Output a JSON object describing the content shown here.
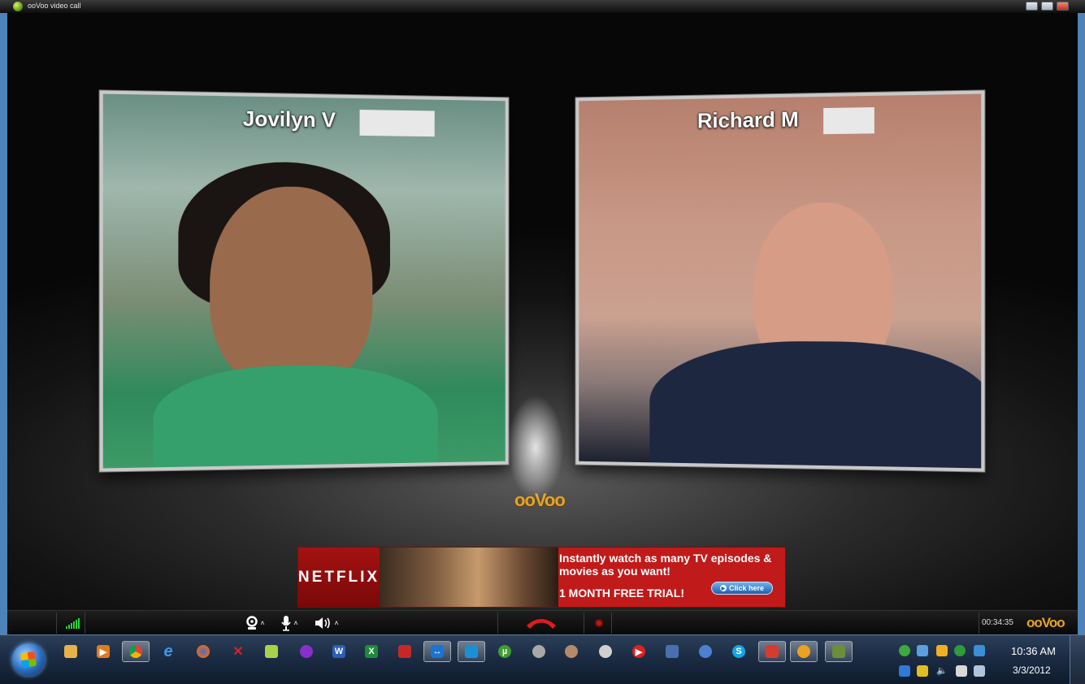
{
  "window": {
    "title": "ooVoo video call"
  },
  "call": {
    "participants": [
      {
        "name": "Jovilyn V"
      },
      {
        "name": "Richard M"
      }
    ],
    "brand": "ooVoo",
    "duration": "00:34:35"
  },
  "ad": {
    "brand": "NETFLIX",
    "headline": "Instantly watch as many TV episodes & movies as you want!",
    "offer": "1 MONTH FREE TRIAL!",
    "button": "Click here"
  },
  "controls": {
    "camera_icon": "webcam-icon",
    "mic_icon": "microphone-icon",
    "speaker_icon": "speaker-icon",
    "hangup_icon": "hang-up-icon",
    "record_icon": "record-icon"
  },
  "taskbar": {
    "icons": [
      "windows-explorer",
      "media-player",
      "chrome",
      "internet-explorer",
      "firefox",
      "xmarks",
      "notes",
      "yahoo-messenger",
      "word",
      "excel",
      "acrobat-reader",
      "teamviewer",
      "virtualbox",
      "utorrent",
      "app-round",
      "app-round-2",
      "webcam-app",
      "youtube-player",
      "network-tool",
      "globe-app",
      "skype",
      "pdf-app",
      "oovoo",
      "dictation-app"
    ],
    "active": [
      2,
      11,
      12,
      21,
      22,
      23
    ]
  },
  "clock": {
    "time": "10:36 AM",
    "date": "3/3/2012"
  },
  "colors": {
    "accent": "#e8a322",
    "window_border": "#4e83b9",
    "ad_red": "#c11a1a",
    "hangup": "#e01c1c",
    "signal": "#27d23f"
  }
}
